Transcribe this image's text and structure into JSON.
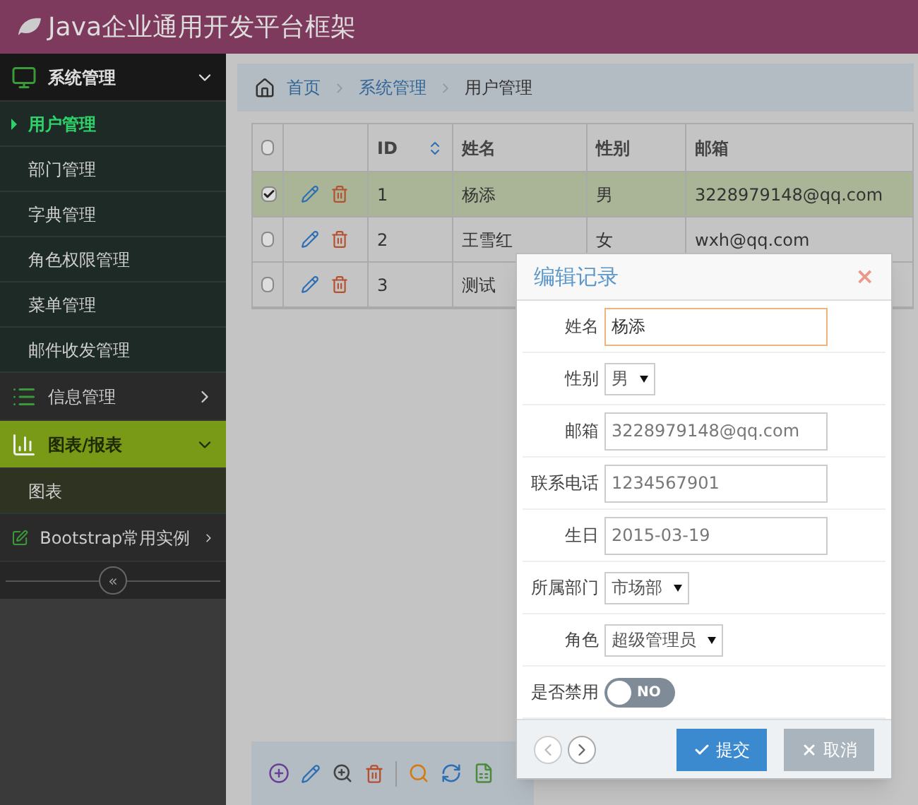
{
  "header": {
    "title": "Java企业通用开发平台框架"
  },
  "sidebar": {
    "groups": [
      {
        "label": "系统管理",
        "expanded": true,
        "selected": false,
        "children": [
          {
            "label": "用户管理",
            "selected": true
          },
          {
            "label": "部门管理",
            "selected": false
          },
          {
            "label": "字典管理",
            "selected": false
          },
          {
            "label": "角色权限管理",
            "selected": false
          },
          {
            "label": "菜单管理",
            "selected": false
          },
          {
            "label": "邮件收发管理",
            "selected": false
          }
        ]
      },
      {
        "label": "信息管理",
        "expanded": false,
        "selected": false
      },
      {
        "label": "图表/报表",
        "expanded": true,
        "selected": true,
        "children": [
          {
            "label": "图表",
            "selected": false
          }
        ]
      },
      {
        "label": "Bootstrap常用实例",
        "expanded": false,
        "selected": false
      }
    ],
    "collapse": "«"
  },
  "breadcrumb": [
    "首页",
    "系统管理",
    "用户管理"
  ],
  "table": {
    "all_checked": false,
    "columns": [
      {
        "label": "ID",
        "sortable": true
      },
      {
        "label": "姓名",
        "sortable": false
      },
      {
        "label": "性别",
        "sortable": false
      },
      {
        "label": "邮箱",
        "sortable": false
      }
    ],
    "rows": [
      {
        "selected": true,
        "cells": [
          "1",
          "杨添",
          "男",
          "3228979148@qq.com"
        ]
      },
      {
        "selected": false,
        "cells": [
          "2",
          "王雪红",
          "女",
          "wxh@qq.com"
        ]
      },
      {
        "selected": false,
        "cells": [
          "3",
          "测试"
        ]
      }
    ]
  },
  "dialog": {
    "title": "编辑记录",
    "close": "×",
    "fields": [
      {
        "kind": "text",
        "label": "姓名",
        "value": "杨添",
        "focused": true
      },
      {
        "kind": "select",
        "label": "性别",
        "value": "男"
      },
      {
        "kind": "text",
        "label": "邮箱",
        "value": "3228979148@qq.com",
        "focused": false
      },
      {
        "kind": "text",
        "label": "联系电话",
        "value": "1234567901",
        "focused": false
      },
      {
        "kind": "text",
        "label": "生日",
        "value": "2015-03-19",
        "focused": false
      },
      {
        "kind": "select",
        "label": "所属部门",
        "value": "市场部"
      },
      {
        "kind": "select",
        "label": "角色",
        "value": "超级管理员"
      },
      {
        "kind": "toggle",
        "label": "是否禁用",
        "on": false,
        "text": "NO"
      }
    ],
    "submit": "提交",
    "cancel": "取消"
  }
}
